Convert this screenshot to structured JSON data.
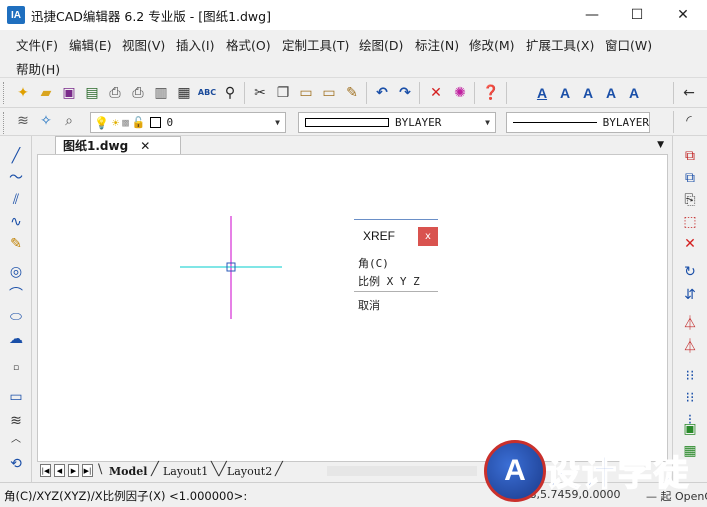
{
  "window": {
    "app_icon": "IA",
    "title": "迅捷CAD编辑器 6.2 专业版  - [图纸1.dwg]",
    "minimize_glyph": "—",
    "maximize_glyph": "☐",
    "close_glyph": "✕"
  },
  "menu": {
    "items": [
      "文件(F)",
      "编辑(E)",
      "视图(V)",
      "插入(I)",
      "格式(O)",
      "定制工具(T)",
      "绘图(D)",
      "标注(N)",
      "修改(M)",
      "扩展工具(X)",
      "窗口(W)",
      "帮助(H)"
    ]
  },
  "toolbar2": {
    "layer_value": "0",
    "color_value": "BYLAYER",
    "linetype_value": "BYLAYER"
  },
  "document": {
    "tab_label": "图纸1.dwg",
    "tab_close": "✕"
  },
  "popup": {
    "title": "XREF",
    "close": "x",
    "items": [
      "角(C)",
      "比例 X Y Z",
      "取消"
    ]
  },
  "layout_tabs": {
    "tabs": [
      "Model",
      "Layout1",
      "Layout2"
    ]
  },
  "status": {
    "command": "角(C)/XYZ(XYZ)/X比例因子(X) <1.000000>:",
    "coords": "3.868,5.7459,0.0000",
    "right": "— 起 OpenGL"
  },
  "watermark": {
    "logo": "A",
    "text": "设计学徒"
  },
  "colors": {
    "crosshair_vertical": "#cc00cc",
    "crosshair_horizontal": "#00cccc",
    "popup_close": "#d9534f",
    "accent_blue": "#1f6fbf"
  },
  "icons": {
    "toolbar1": [
      "new-icon",
      "open-icon",
      "save-icon",
      "save-as-icon",
      "print-icon",
      "print-preview-icon",
      "plot-icon",
      "spell-check-icon",
      "find-icon",
      "cut-icon",
      "copy-icon",
      "paste-icon",
      "paste-special-icon",
      "match-properties-icon",
      "undo-icon",
      "redo-icon",
      "delete-icon",
      "purge-icon",
      "help-icon",
      "text-style-icon",
      "text-icon",
      "multiline-text-icon",
      "edit-text-icon",
      "find-text-icon"
    ],
    "left_tools": [
      "line-icon",
      "polyline-icon",
      "multiline-icon",
      "spline-icon",
      "freehand-icon",
      "circle-icon",
      "arc-icon",
      "ellipse-icon",
      "revision-cloud-icon",
      "point-icon",
      "rectangle-icon",
      "helix-icon",
      "collapse-icon",
      "regen-icon"
    ],
    "right_tools": [
      "move-icon",
      "copy-object-icon",
      "rotate-icon",
      "stretch-icon",
      "erase-icon",
      "rotate-ccw-icon",
      "mirror-horizontal-icon",
      "mirror-icon",
      "array-icon",
      "offset-icon",
      "array-rect-icon",
      "break-icon",
      "scale-icon",
      "explode-icon"
    ]
  }
}
